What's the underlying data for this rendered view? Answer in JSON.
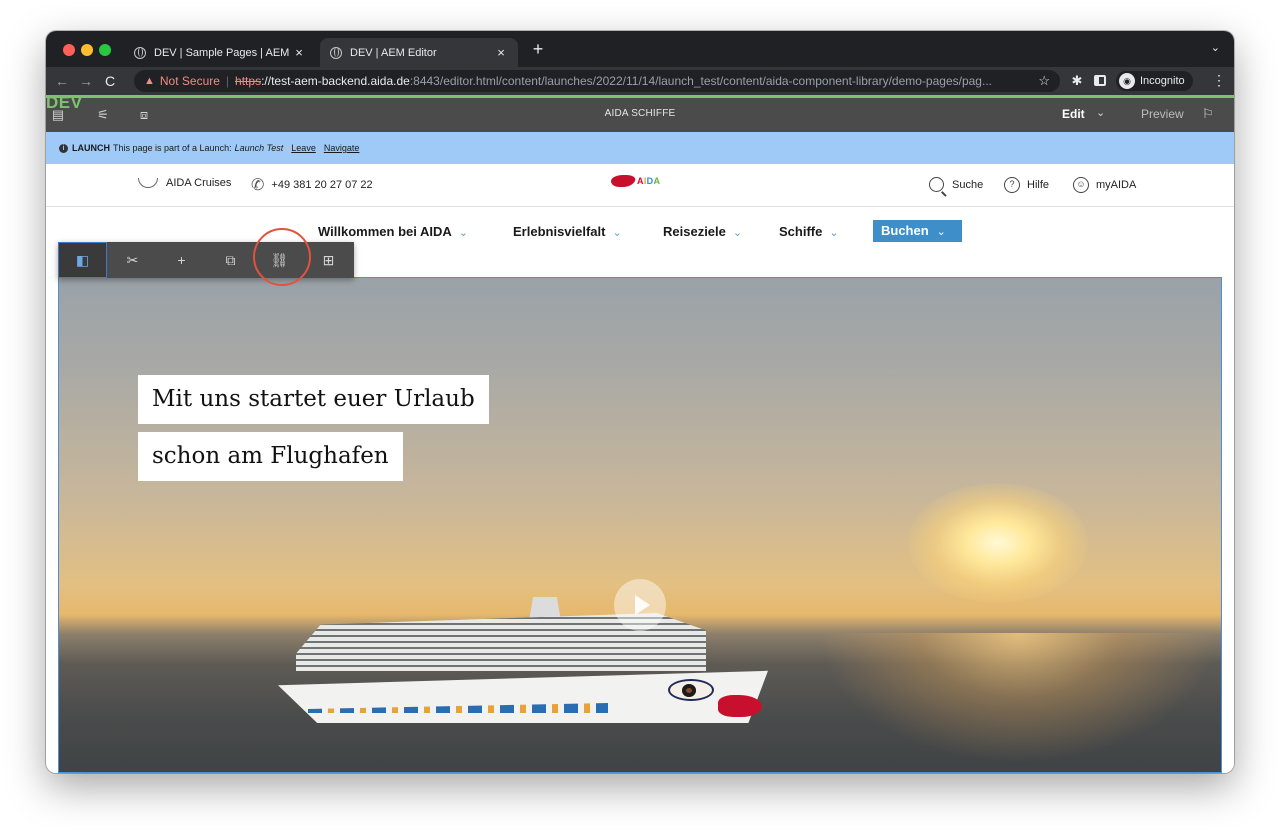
{
  "browser": {
    "tabs": [
      {
        "title": "DEV | Sample Pages | AEM Site",
        "close": "×",
        "active": false
      },
      {
        "title": "DEV | AEM Editor",
        "close": "×",
        "active": true
      }
    ],
    "new_tab": "+",
    "tab_menu": "⌄",
    "address": {
      "warning": "Not Secure",
      "separator": "|",
      "scheme": "https",
      "host": "://test-aem-backend.aida.de",
      "rest": ":8443/editor.html/content/launches/2022/11/14/launch_test/content/aida-component-library/demo-pages/pag..."
    },
    "incognito_label": "Incognito",
    "nav": {
      "back": "←",
      "forward": "→",
      "reload": "C"
    }
  },
  "aem": {
    "env_badge": "DEV",
    "title": "AIDA SCHIFFE",
    "mode": "Edit",
    "mode_chevron": "⌄",
    "preview": "Preview",
    "icons": [
      "page-properties-icon",
      "settings-sliders-icon",
      "emulator-icon",
      "annotations-icon"
    ]
  },
  "launch": {
    "label": "LAUNCH",
    "text": "This page is part of a Launch:",
    "launch_name": "Launch Test",
    "leave": "Leave",
    "navigate": "Navigate"
  },
  "site": {
    "brand": "AIDA Cruises",
    "phone": "+49 381 20 27 07 22",
    "logo_letters": [
      "A",
      "I",
      "D",
      "A"
    ],
    "search": "Suche",
    "help": "Hilfe",
    "account": "myAIDA",
    "nav": [
      {
        "label": "Willkommen bei AIDA"
      },
      {
        "label": "Erlebnisvielfalt"
      },
      {
        "label": "Reiseziele"
      },
      {
        "label": "Schiffe"
      }
    ],
    "cta": "Buchen",
    "chevron": "⌄"
  },
  "hero": {
    "headline_line1": "Mit uns startet euer Urlaub",
    "headline_line2": "schon am Flughafen"
  },
  "component_toolbar": {
    "buttons": [
      {
        "name": "select-parent-icon",
        "glyph": "◧",
        "selected": true
      },
      {
        "name": "cut-icon",
        "glyph": "✂",
        "selected": false
      },
      {
        "name": "insert-icon",
        "glyph": "+",
        "selected": false
      },
      {
        "name": "copy-icon",
        "glyph": "⧉",
        "selected": false
      },
      {
        "name": "link-icon",
        "glyph": "⛓",
        "selected": false
      },
      {
        "name": "layout-icon",
        "glyph": "⊞",
        "selected": false
      }
    ]
  },
  "colors": {
    "aem_bar": "#4b4b4b",
    "launch_bar": "#9fc9f7",
    "buchen": "#3d8ec9",
    "component_outline": "#4a8fd8",
    "highlight_ring": "#e0533e",
    "dev_badge": "#7ec271"
  }
}
